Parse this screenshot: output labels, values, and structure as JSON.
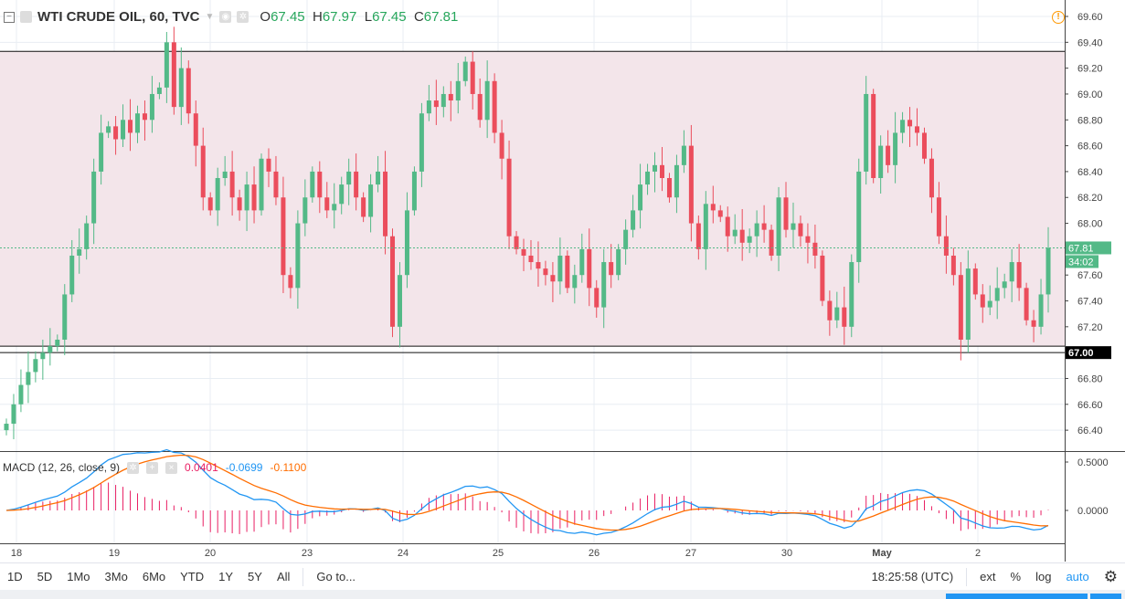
{
  "header": {
    "title": "WTI CRUDE OIL, 60, TVC",
    "open_label": "O",
    "open": "67.45",
    "high_label": "H",
    "high": "67.97",
    "low_label": "L",
    "low": "67.45",
    "close_label": "C",
    "close": "67.81"
  },
  "macd": {
    "label": "MACD (12, 26, close, 9)",
    "hist": "0.0401",
    "macd": "-0.0699",
    "signal": "-0.1100",
    "axis": [
      "0.5000",
      "0.0000"
    ]
  },
  "price_axis": {
    "ticks": [
      "69.60",
      "69.40",
      "69.20",
      "69.00",
      "68.80",
      "68.60",
      "68.40",
      "68.20",
      "68.00",
      "67.60",
      "67.40",
      "67.20",
      "66.80",
      "66.60",
      "66.40"
    ],
    "last_price": "67.81",
    "countdown": "34:02",
    "level_label": "67.00"
  },
  "time_axis": [
    "18",
    "19",
    "20",
    "23",
    "24",
    "25",
    "26",
    "27",
    "30",
    "May",
    "2"
  ],
  "toolbar": {
    "ranges": [
      "1D",
      "5D",
      "1Mo",
      "3Mo",
      "6Mo",
      "YTD",
      "1Y",
      "5Y",
      "All"
    ],
    "goto": "Go to...",
    "time": "18:25:58 (UTC)",
    "ext": "ext",
    "percent": "%",
    "log": "log",
    "auto": "auto"
  },
  "colors": {
    "up": "#53b987",
    "down": "#eb4d5c",
    "macd": "#2196f3",
    "signal": "#ff6d00",
    "hist": "#e91e63",
    "zone": "#f3e5ea"
  },
  "chart_data": {
    "type": "candlestick",
    "symbol": "WTI CRUDE OIL",
    "interval": "60",
    "ylim": [
      66.3,
      69.7
    ],
    "levels": [
      69.33,
      67.05,
      67.0
    ],
    "first_open": 66.4,
    "closes": [
      66.45,
      66.6,
      66.75,
      66.85,
      66.95,
      67.0,
      67.05,
      67.1,
      67.45,
      67.75,
      67.8,
      68.0,
      68.4,
      68.7,
      68.75,
      68.65,
      68.8,
      68.7,
      68.85,
      68.8,
      69.0,
      69.05,
      69.4,
      68.9,
      69.2,
      68.85,
      68.6,
      68.2,
      68.1,
      68.35,
      68.4,
      68.2,
      68.1,
      68.3,
      68.1,
      68.5,
      68.4,
      68.2,
      67.6,
      67.5,
      68.0,
      68.2,
      68.4,
      68.2,
      68.1,
      68.15,
      68.3,
      68.4,
      68.2,
      68.05,
      68.3,
      68.4,
      67.9,
      67.2,
      67.6,
      68.1,
      68.4,
      68.85,
      68.95,
      68.9,
      69.0,
      68.95,
      69.1,
      69.25,
      69.0,
      68.8,
      69.1,
      68.7,
      68.5,
      67.9,
      67.8,
      67.75,
      67.7,
      67.65,
      67.6,
      67.55,
      67.75,
      67.5,
      67.6,
      67.8,
      67.5,
      67.35,
      67.7,
      67.6,
      67.8,
      67.95,
      68.1,
      68.3,
      68.4,
      68.45,
      68.35,
      68.2,
      68.45,
      68.6,
      68.0,
      67.8,
      68.15,
      68.1,
      68.05,
      67.9,
      67.95,
      67.85,
      67.9,
      68.0,
      67.95,
      67.75,
      68.2,
      67.95,
      68.0,
      67.9,
      67.85,
      67.75,
      67.4,
      67.25,
      67.35,
      67.2,
      67.7,
      68.4,
      69.0,
      68.35,
      68.6,
      68.45,
      68.7,
      68.8,
      68.75,
      68.7,
      68.5,
      68.2,
      67.9,
      67.75,
      67.6,
      67.1,
      67.65,
      67.45,
      67.35,
      67.4,
      67.5,
      67.55,
      67.7,
      67.5,
      67.25,
      67.2,
      67.45,
      67.81
    ]
  }
}
